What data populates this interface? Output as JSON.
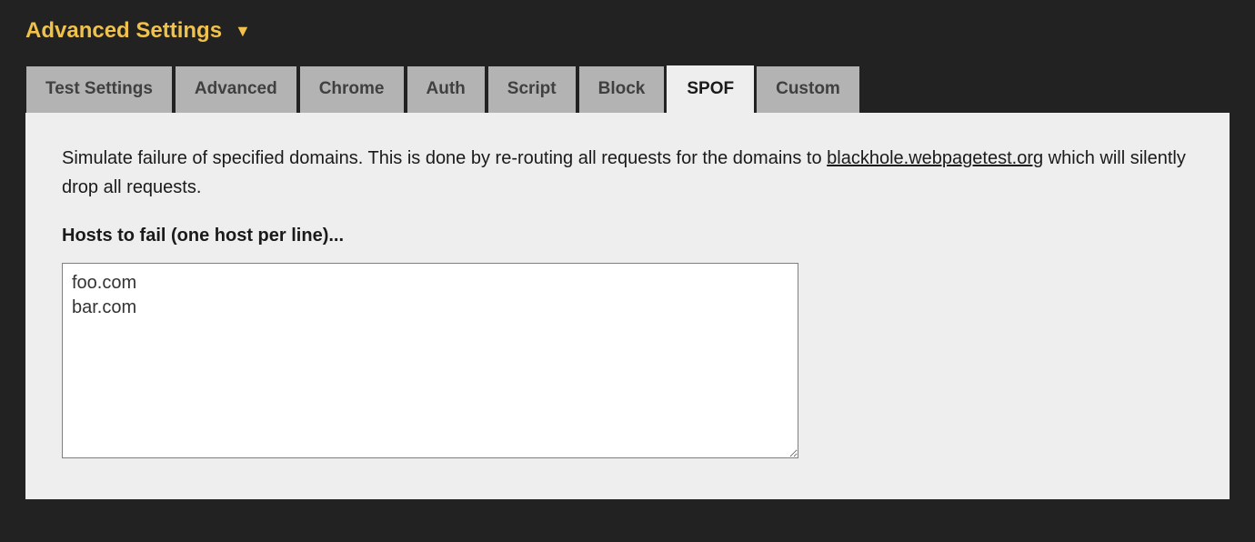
{
  "header": {
    "title": "Advanced Settings"
  },
  "tabs": [
    {
      "label": "Test Settings"
    },
    {
      "label": "Advanced"
    },
    {
      "label": "Chrome"
    },
    {
      "label": "Auth"
    },
    {
      "label": "Script"
    },
    {
      "label": "Block"
    },
    {
      "label": "SPOF"
    },
    {
      "label": "Custom"
    }
  ],
  "panel": {
    "desc_part1": "Simulate failure of specified domains. This is done by re-routing all requests for the domains to ",
    "desc_link": "blackhole.webpagetest.org",
    "desc_part2": " which will silently drop all requests.",
    "field_label": "Hosts to fail (one host per line)...",
    "hosts_value": "foo.com\nbar.com"
  }
}
